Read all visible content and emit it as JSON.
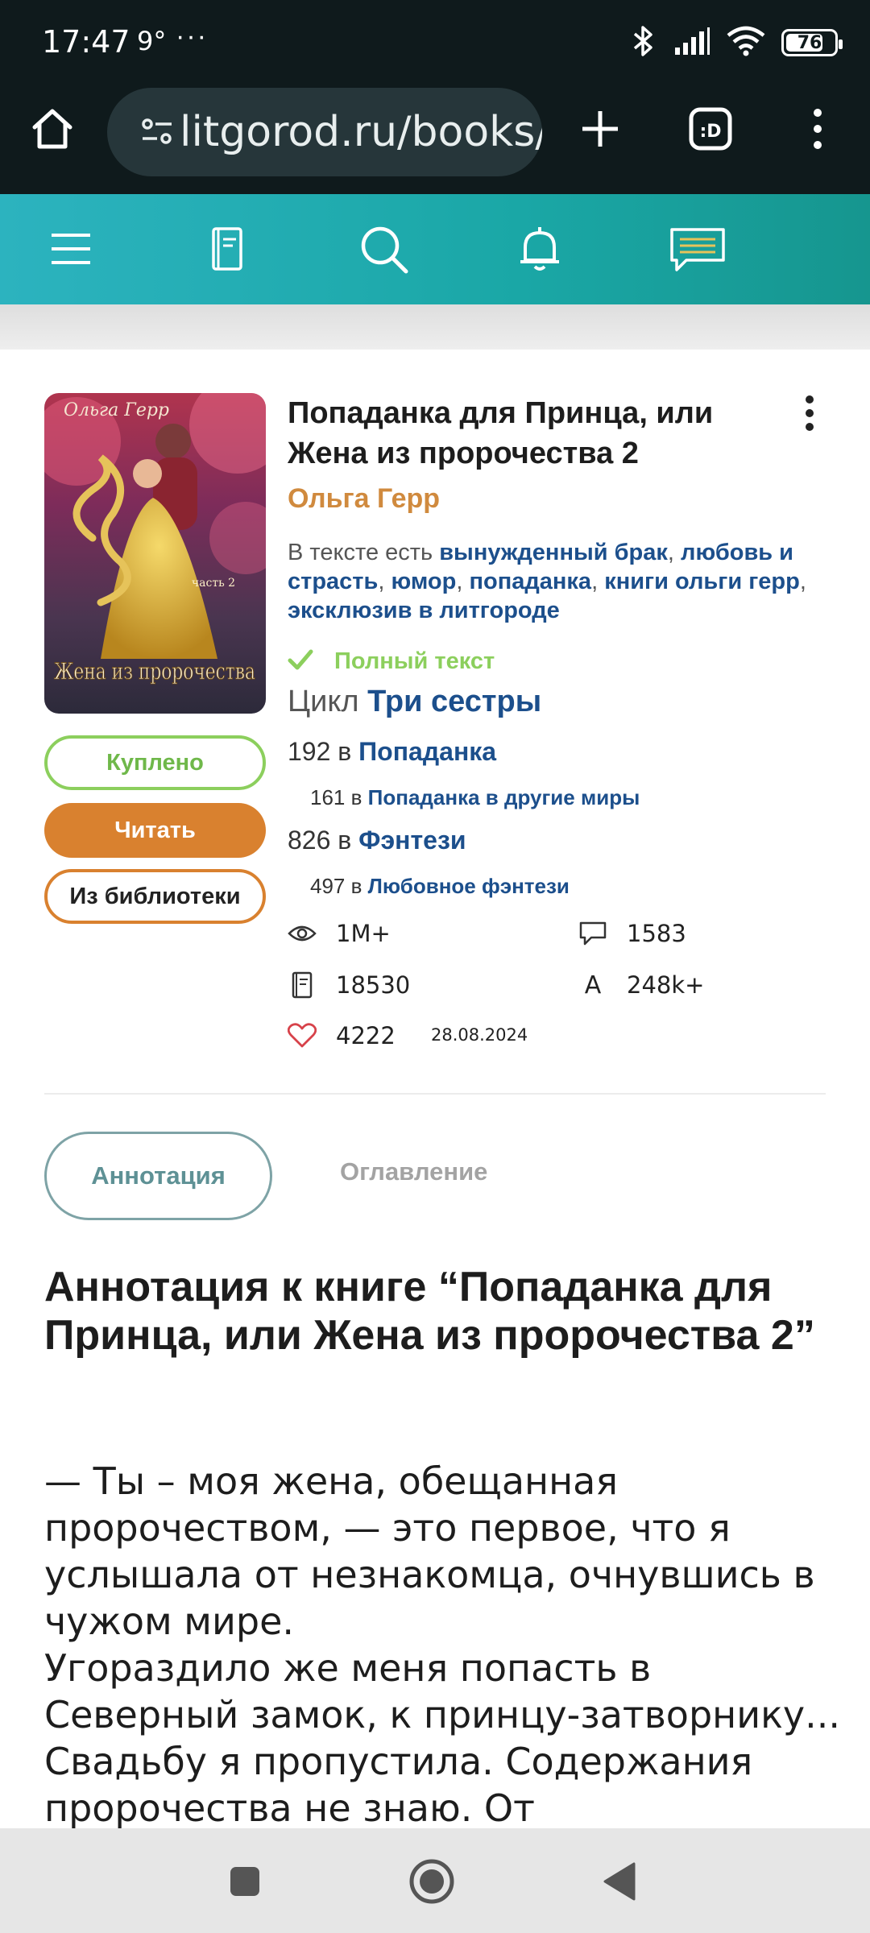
{
  "status_bar": {
    "time": "17:47",
    "temperature": "9°",
    "more": "···",
    "battery": "76",
    "icons": [
      "bluetooth-icon",
      "signal-icon",
      "wifi-icon",
      "battery-icon"
    ]
  },
  "browser": {
    "url": "litgorod.ru/books/",
    "icons": [
      "home-icon",
      "site-settings-icon",
      "new-tab-plus-icon",
      "tab-switcher-icon",
      "menu-dots-icon"
    ],
    "tab_switcher_label": ":D"
  },
  "site_nav": {
    "icons": [
      "hamburger-menu-icon",
      "book-icon",
      "search-icon",
      "bell-icon",
      "messages-icon"
    ],
    "accent_color": "#1aa7a6"
  },
  "book": {
    "title": "Попаданка для Принца, или Жена из пророчества 2",
    "author": "Ольга Герр",
    "tags_prefix": "В тексте есть",
    "tags": [
      "вынужденный брак",
      "любовь и страсть",
      "юмор",
      "попаданка",
      "книги ольги герр",
      "эксклюзив в литгороде"
    ],
    "full_text_label": "Полный текст",
    "cycle_prefix": "Цикл",
    "cycle_name": "Три сестры",
    "cover": {
      "author_text": "Ольга Герр",
      "title_text": "Жена из пророчества",
      "part_text": "часть 2"
    },
    "rankings": [
      {
        "place": "192",
        "in": "в",
        "genre": "Попаданка",
        "level": "main"
      },
      {
        "place": "161",
        "in": "в",
        "genre": "Попаданка в другие миры",
        "level": "sub"
      },
      {
        "place": "826",
        "in": "в",
        "genre": "Фэнтези",
        "level": "main"
      },
      {
        "place": "497",
        "in": "в",
        "genre": "Любовное фэнтези",
        "level": "sub"
      }
    ],
    "stats": {
      "views": "1M+",
      "comments": "1583",
      "pages": "18530",
      "characters": "248k+",
      "characters_icon_letter": "A",
      "likes": "4222",
      "date": "28.08.2024"
    },
    "buttons": {
      "bought": "Куплено",
      "read": "Читать",
      "remove": "Из библиотеки"
    }
  },
  "tabs": {
    "annotation": "Аннотация",
    "contents": "Оглавление"
  },
  "annotation": {
    "heading": "Аннотация к книге “Попаданка для Принца, или Жена из пророчества 2”",
    "body_lines": [
      "— Ты – моя жена, обещанная пророчеством, — это первое, что я услышала от незнакомца, очнувшись в чужом мире.",
      "Угораздило же меня попасть в Северный замок, к принцу-затворнику... Свадьбу я пропустила. Содержания пророчества не знаю. От"
    ]
  },
  "system_nav": {
    "icons": [
      "recents-square-icon",
      "home-circle-icon",
      "back-triangle-icon"
    ]
  }
}
